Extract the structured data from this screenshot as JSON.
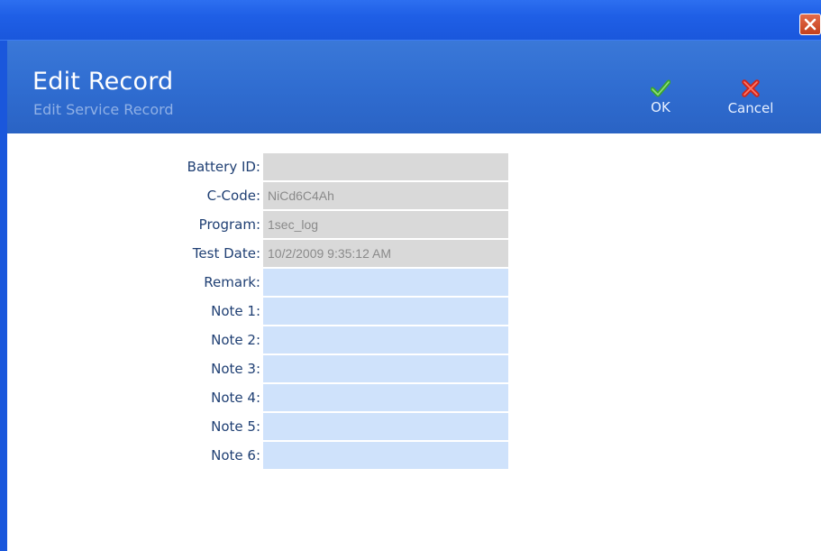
{
  "window": {
    "close_icon": "close-icon",
    "titlebar_color": "#1f5fe6"
  },
  "header": {
    "title": "Edit Record",
    "subtitle": "Edit Service Record",
    "background": "#2f6cd0"
  },
  "toolbar": {
    "ok_label": "OK",
    "ok_icon": "checkmark-icon",
    "cancel_label": "Cancel",
    "cancel_icon": "x-icon"
  },
  "form": {
    "fields": [
      {
        "label": "Battery ID:",
        "value": "",
        "readonly": true
      },
      {
        "label": "C-Code:",
        "value": "NiCd6C4Ah",
        "readonly": true
      },
      {
        "label": "Program:",
        "value": "1sec_log",
        "readonly": true
      },
      {
        "label": "Test Date:",
        "value": "10/2/2009 9:35:12 AM",
        "readonly": true
      },
      {
        "label": "Remark:",
        "value": "",
        "readonly": false
      },
      {
        "label": "Note 1:",
        "value": "",
        "readonly": false
      },
      {
        "label": "Note 2:",
        "value": "",
        "readonly": false
      },
      {
        "label": "Note 3:",
        "value": "",
        "readonly": false
      },
      {
        "label": "Note 4:",
        "value": "",
        "readonly": false
      },
      {
        "label": "Note 5:",
        "value": "",
        "readonly": false
      },
      {
        "label": "Note 6:",
        "value": "",
        "readonly": false
      }
    ],
    "readonly_color": "#d9d9d9",
    "editable_color": "#cfe2fb"
  }
}
